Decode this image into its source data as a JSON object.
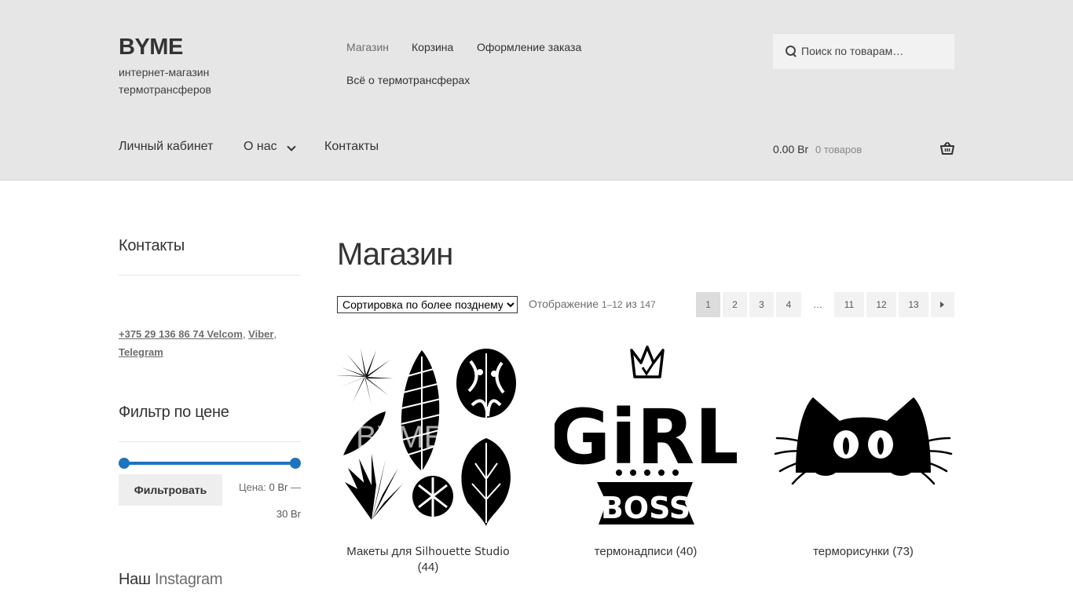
{
  "site": {
    "title": "BYME",
    "description": "интернет-магазин термотрансферов"
  },
  "top_nav": [
    {
      "label": "Магазин",
      "current": true
    },
    {
      "label": "Корзина"
    },
    {
      "label": "Оформление заказа"
    },
    {
      "label": "Всё о термотрансферах"
    }
  ],
  "search": {
    "placeholder": "Поиск по товарам…"
  },
  "main_nav": [
    {
      "label": "Личный кабинет"
    },
    {
      "label": "О нас",
      "has_submenu": true
    },
    {
      "label": "Контакты"
    }
  ],
  "cart": {
    "amount": "0.00 Br",
    "count_text": "0 товаров"
  },
  "sidebar": {
    "contacts_title": "Контакты",
    "contacts_phone": "+375 29 136 86 74 Velcom",
    "contacts_viber": "Viber",
    "contacts_telegram": "Telegram",
    "filter_title": "Фильтр по цене",
    "filter_button": "Фильтровать",
    "price_prefix": "Цена:",
    "price_min": "0 Br",
    "price_sep": "—",
    "price_max": "30 Br",
    "instagram_title_a": "Наш",
    "instagram_title_b": "Instagram"
  },
  "shop": {
    "title": "Магазин",
    "sort_selected": "Сортировка по более позднему",
    "result_word": "Отображение",
    "result_range": "1–12",
    "result_of": "из",
    "result_total": "147",
    "pages": [
      "1",
      "2",
      "3",
      "4",
      "…",
      "11",
      "12",
      "13"
    ],
    "current_page": "1"
  },
  "products": [
    {
      "name_a": "Макеты для",
      "name_b": "Silhouette Studio",
      "count": "(44)",
      "watermark": "BYME",
      "icon": "tropical-leaves-image"
    },
    {
      "name": "термонадписи (40)",
      "icon": "girl-boss-image",
      "text_top": "GiRL",
      "text_bottom": "BOSS"
    },
    {
      "name": "терморисунки (73)",
      "icon": "cat-silhouette-image"
    }
  ],
  "colors": {
    "header_bg": "#e6e6e6",
    "accent": "#1e73be",
    "text": "#333333",
    "muted": "#6d6d6d"
  }
}
